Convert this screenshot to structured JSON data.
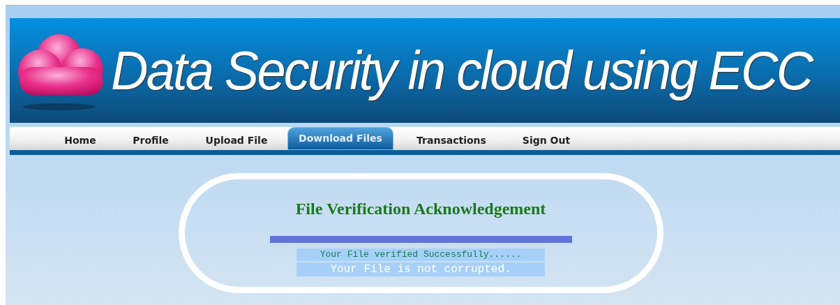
{
  "banner": {
    "title": "Data Security in cloud using ECC"
  },
  "nav": [
    {
      "label": "Home",
      "selected": false
    },
    {
      "label": "Profile",
      "selected": false
    },
    {
      "label": "Upload File",
      "selected": false
    },
    {
      "label": "Download Files",
      "selected": true
    },
    {
      "label": "Transactions",
      "selected": false
    },
    {
      "label": "Sign Out",
      "selected": false
    }
  ],
  "card": {
    "heading": "File Verification Acknowledgement",
    "messages": [
      "Your File verified Successfully......",
      "Your File is not corrupted."
    ]
  }
}
